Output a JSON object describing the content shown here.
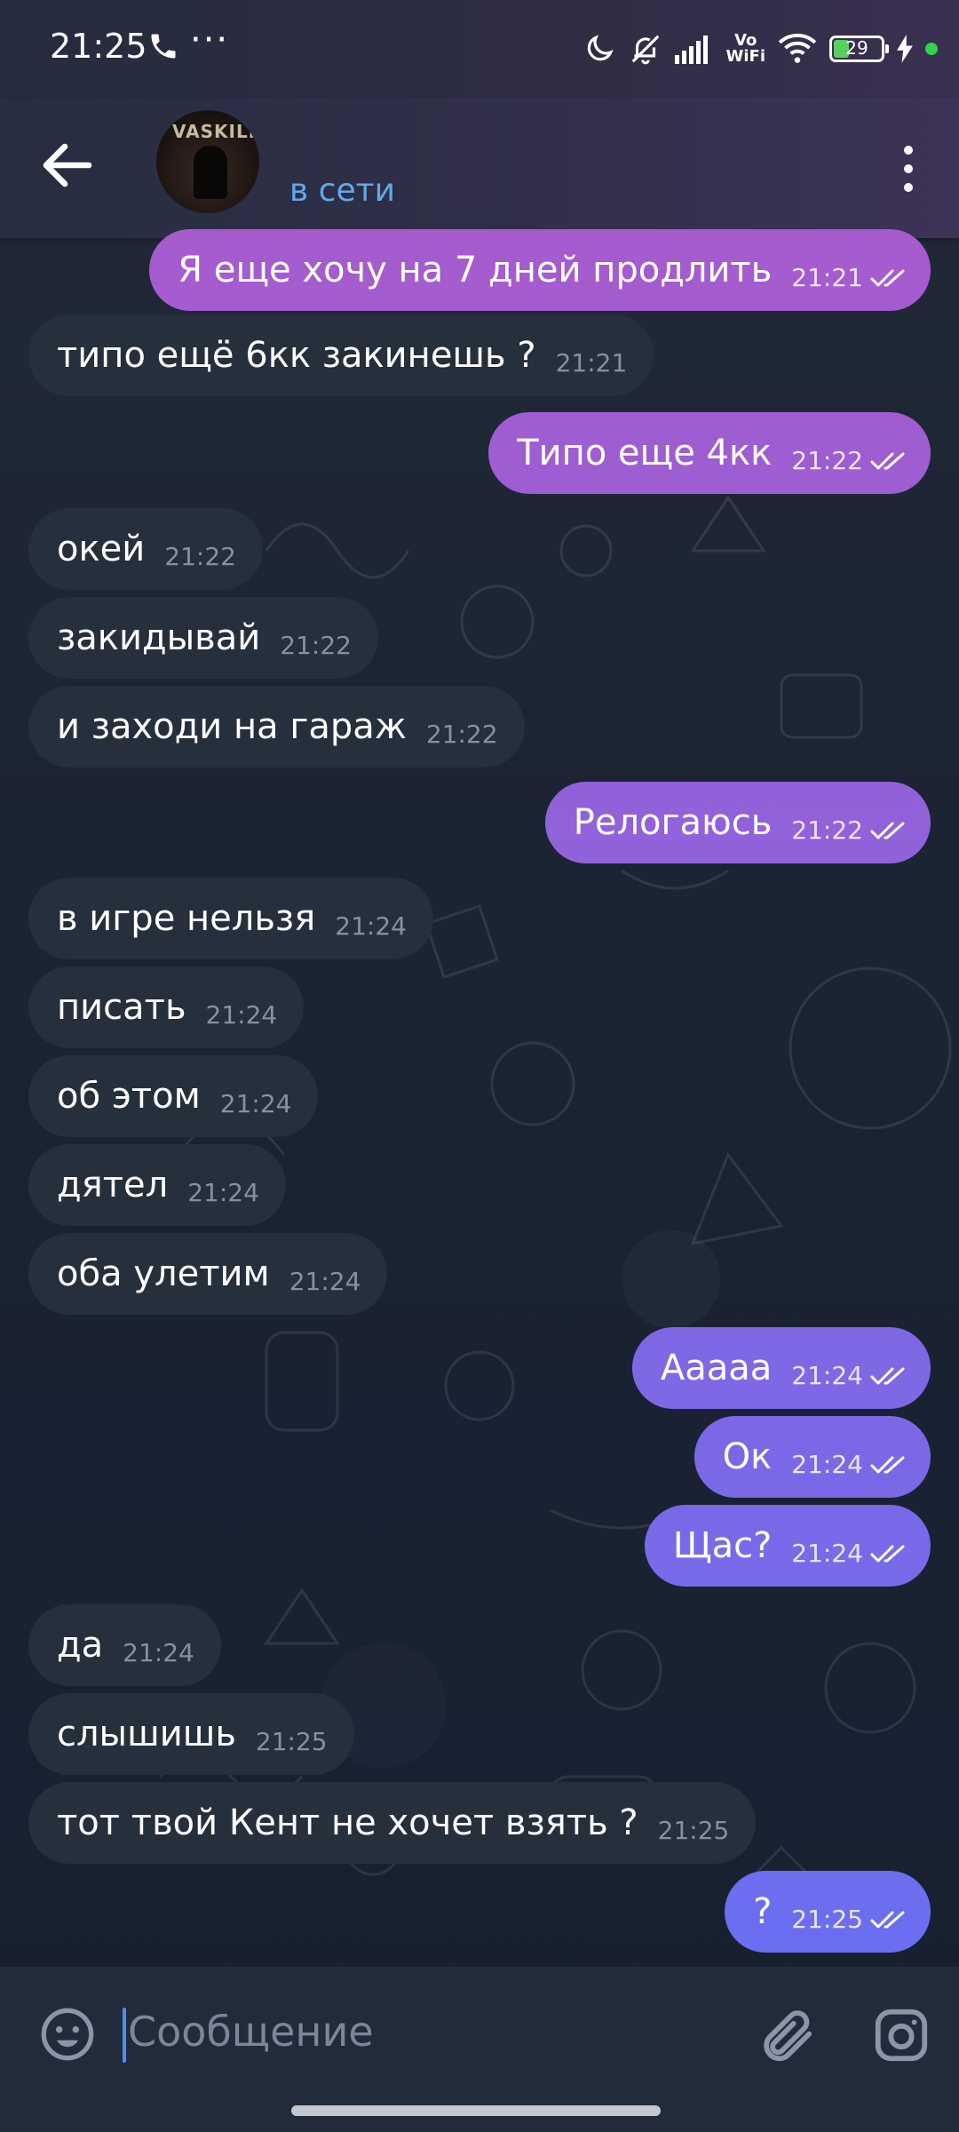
{
  "status_bar": {
    "time": "21:25",
    "dots": "···",
    "vowifi_line1": "Vo",
    "vowifi_line2": "WiFi",
    "battery_percent": "29",
    "icons": [
      "phone-icon",
      "moon-icon",
      "bell-off-icon",
      "signal-icon",
      "wifi-icon",
      "battery-icon",
      "charging-icon"
    ]
  },
  "header": {
    "avatar_text": "VASKILL",
    "status": "в сети",
    "icons": [
      "back-arrow-icon",
      "more-vert-icon"
    ]
  },
  "colors": {
    "background": "#182130",
    "incoming_bubble": "#262f3c",
    "online_text": "#62a8ea",
    "outgoing_gradient_top": "#a65bcd",
    "outgoing_gradient_bottom": "#6b6ef0"
  },
  "messages": [
    {
      "dir": "out",
      "text": "Я еще хочу на 7 дней продлить",
      "time": "21:21"
    },
    {
      "dir": "in",
      "text": "типо ещё 6кк закинешь ?",
      "time": "21:21"
    },
    {
      "dir": "out",
      "text": "Типо еще 4кк",
      "time": "21:22"
    },
    {
      "dir": "in",
      "text": "окей",
      "time": "21:22"
    },
    {
      "dir": "in",
      "text": "закидывай",
      "time": "21:22"
    },
    {
      "dir": "in",
      "text": "и заходи на гараж",
      "time": "21:22"
    },
    {
      "dir": "out",
      "text": "Релогаюсь",
      "time": "21:22"
    },
    {
      "dir": "in",
      "text": "в игре нельзя",
      "time": "21:24"
    },
    {
      "dir": "in",
      "text": "писать",
      "time": "21:24"
    },
    {
      "dir": "in",
      "text": "об этом",
      "time": "21:24"
    },
    {
      "dir": "in",
      "text": "дятел",
      "time": "21:24"
    },
    {
      "dir": "in",
      "text": "оба улетим",
      "time": "21:24"
    },
    {
      "dir": "out",
      "text": "Ааааа",
      "time": "21:24"
    },
    {
      "dir": "out",
      "text": "Ок",
      "time": "21:24"
    },
    {
      "dir": "out",
      "text": "Щас?",
      "time": "21:24"
    },
    {
      "dir": "in",
      "text": "да",
      "time": "21:24"
    },
    {
      "dir": "in",
      "text": "слышишь",
      "time": "21:25"
    },
    {
      "dir": "in",
      "text": "тот твой Кент не хочет взять ?",
      "time": "21:25"
    },
    {
      "dir": "out",
      "text": "?",
      "time": "21:25"
    }
  ],
  "input": {
    "placeholder": "Сообщение",
    "icons": [
      "emoji-icon",
      "attach-icon",
      "camera-icon"
    ]
  }
}
